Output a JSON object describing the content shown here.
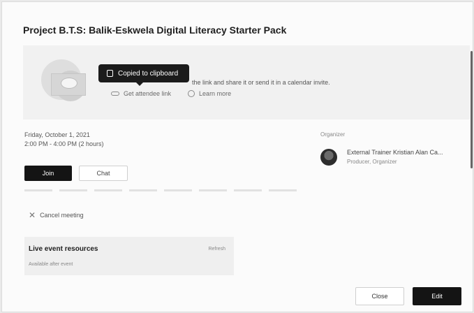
{
  "dialog": {
    "title": "Project B.T.S: Balik-Eskwela Digital Literacy Starter Pack"
  },
  "share": {
    "tooltip": "Copied to clipboard",
    "instruction": "the link and share it or send it in a calendar invite.",
    "attendee_link_label": "Get attendee link",
    "learn_more_label": "Learn more"
  },
  "event": {
    "date": "Friday, October 1, 2021",
    "time": "2:00 PM - 4:00 PM (2 hours)",
    "join_label": "Join",
    "chat_label": "Chat",
    "cancel_label": "Cancel meeting"
  },
  "organizer": {
    "section_label": "Organizer",
    "name": "External Trainer Kristian Alan Ca...",
    "role": "Producer, Organizer"
  },
  "resources": {
    "title": "Live event resources",
    "refresh_label": "Refresh",
    "note": "Available after event"
  },
  "footer": {
    "close_label": "Close",
    "edit_label": "Edit"
  }
}
